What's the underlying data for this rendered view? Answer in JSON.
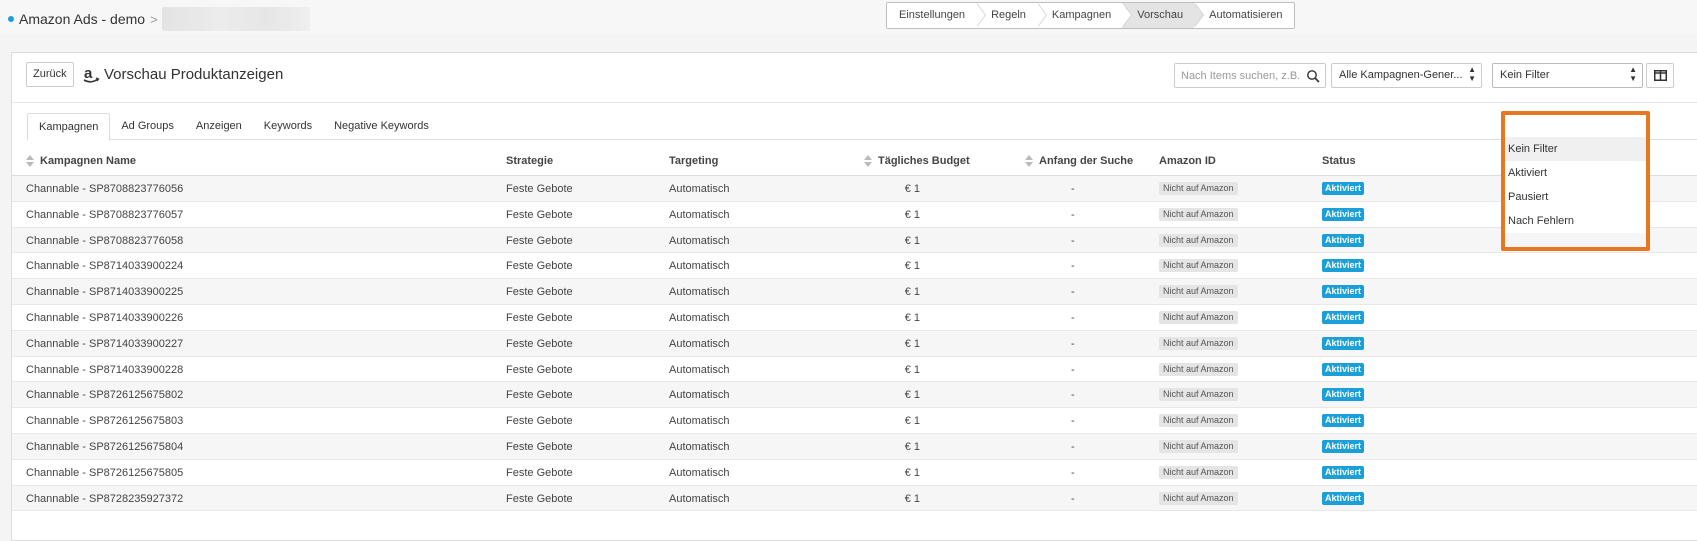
{
  "app": {
    "title": "Amazon Ads - demo",
    "separator": ">"
  },
  "steps": [
    {
      "label": "Einstellungen",
      "active": false
    },
    {
      "label": "Regeln",
      "active": false
    },
    {
      "label": "Kampagnen",
      "active": false
    },
    {
      "label": "Vorschau",
      "active": true
    },
    {
      "label": "Automatisieren",
      "active": false
    }
  ],
  "header": {
    "back_label": "Zurück",
    "title": "Vorschau Produktanzeigen",
    "search_placeholder": "Nach Items suchen, z.B.",
    "campaign_select": "Alle Kampagnen-Gener...",
    "filter_select": "Kein Filter"
  },
  "filter_dropdown": {
    "options": [
      "Kein Filter",
      "Aktiviert",
      "Pausiert",
      "Nach Fehlern"
    ],
    "selected": "Kein Filter"
  },
  "tabs": [
    {
      "label": "Kampagnen",
      "active": true
    },
    {
      "label": "Ad Groups",
      "active": false
    },
    {
      "label": "Anzeigen",
      "active": false
    },
    {
      "label": "Keywords",
      "active": false
    },
    {
      "label": "Negative Keywords",
      "active": false
    }
  ],
  "table": {
    "columns": {
      "name": "Kampagnen Name",
      "strategy": "Strategie",
      "targeting": "Targeting",
      "budget": "Tägliches Budget",
      "start": "Anfang der Suche",
      "amazon_id": "Amazon ID",
      "status": "Status"
    },
    "rows": [
      {
        "name": "Channable - SP8708823776056",
        "strategy": "Feste Gebote",
        "targeting": "Automatisch",
        "budget": "€ 1",
        "start": "-",
        "amazon_id": "Nicht auf Amazon",
        "status": "Aktiviert"
      },
      {
        "name": "Channable - SP8708823776057",
        "strategy": "Feste Gebote",
        "targeting": "Automatisch",
        "budget": "€ 1",
        "start": "-",
        "amazon_id": "Nicht auf Amazon",
        "status": "Aktiviert"
      },
      {
        "name": "Channable - SP8708823776058",
        "strategy": "Feste Gebote",
        "targeting": "Automatisch",
        "budget": "€ 1",
        "start": "-",
        "amazon_id": "Nicht auf Amazon",
        "status": "Aktiviert"
      },
      {
        "name": "Channable - SP8714033900224",
        "strategy": "Feste Gebote",
        "targeting": "Automatisch",
        "budget": "€ 1",
        "start": "-",
        "amazon_id": "Nicht auf Amazon",
        "status": "Aktiviert"
      },
      {
        "name": "Channable - SP8714033900225",
        "strategy": "Feste Gebote",
        "targeting": "Automatisch",
        "budget": "€ 1",
        "start": "-",
        "amazon_id": "Nicht auf Amazon",
        "status": "Aktiviert"
      },
      {
        "name": "Channable - SP8714033900226",
        "strategy": "Feste Gebote",
        "targeting": "Automatisch",
        "budget": "€ 1",
        "start": "-",
        "amazon_id": "Nicht auf Amazon",
        "status": "Aktiviert"
      },
      {
        "name": "Channable - SP8714033900227",
        "strategy": "Feste Gebote",
        "targeting": "Automatisch",
        "budget": "€ 1",
        "start": "-",
        "amazon_id": "Nicht auf Amazon",
        "status": "Aktiviert"
      },
      {
        "name": "Channable - SP8714033900228",
        "strategy": "Feste Gebote",
        "targeting": "Automatisch",
        "budget": "€ 1",
        "start": "-",
        "amazon_id": "Nicht auf Amazon",
        "status": "Aktiviert"
      },
      {
        "name": "Channable - SP8726125675802",
        "strategy": "Feste Gebote",
        "targeting": "Automatisch",
        "budget": "€ 1",
        "start": "-",
        "amazon_id": "Nicht auf Amazon",
        "status": "Aktiviert"
      },
      {
        "name": "Channable - SP8726125675803",
        "strategy": "Feste Gebote",
        "targeting": "Automatisch",
        "budget": "€ 1",
        "start": "-",
        "amazon_id": "Nicht auf Amazon",
        "status": "Aktiviert"
      },
      {
        "name": "Channable - SP8726125675804",
        "strategy": "Feste Gebote",
        "targeting": "Automatisch",
        "budget": "€ 1",
        "start": "-",
        "amazon_id": "Nicht auf Amazon",
        "status": "Aktiviert"
      },
      {
        "name": "Channable - SP8726125675805",
        "strategy": "Feste Gebote",
        "targeting": "Automatisch",
        "budget": "€ 1",
        "start": "-",
        "amazon_id": "Nicht auf Amazon",
        "status": "Aktiviert"
      },
      {
        "name": "Channable - SP8728235927372",
        "strategy": "Feste Gebote",
        "targeting": "Automatisch",
        "budget": "€ 1",
        "start": "-",
        "amazon_id": "Nicht auf Amazon",
        "status": "Aktiviert"
      }
    ]
  },
  "colors": {
    "accent": "#1a9fd9",
    "highlight": "#e87722"
  },
  "icons": {
    "logo": "amazon-icon",
    "search": "search-icon",
    "columns": "columns-icon",
    "sort": "sort-icon"
  }
}
